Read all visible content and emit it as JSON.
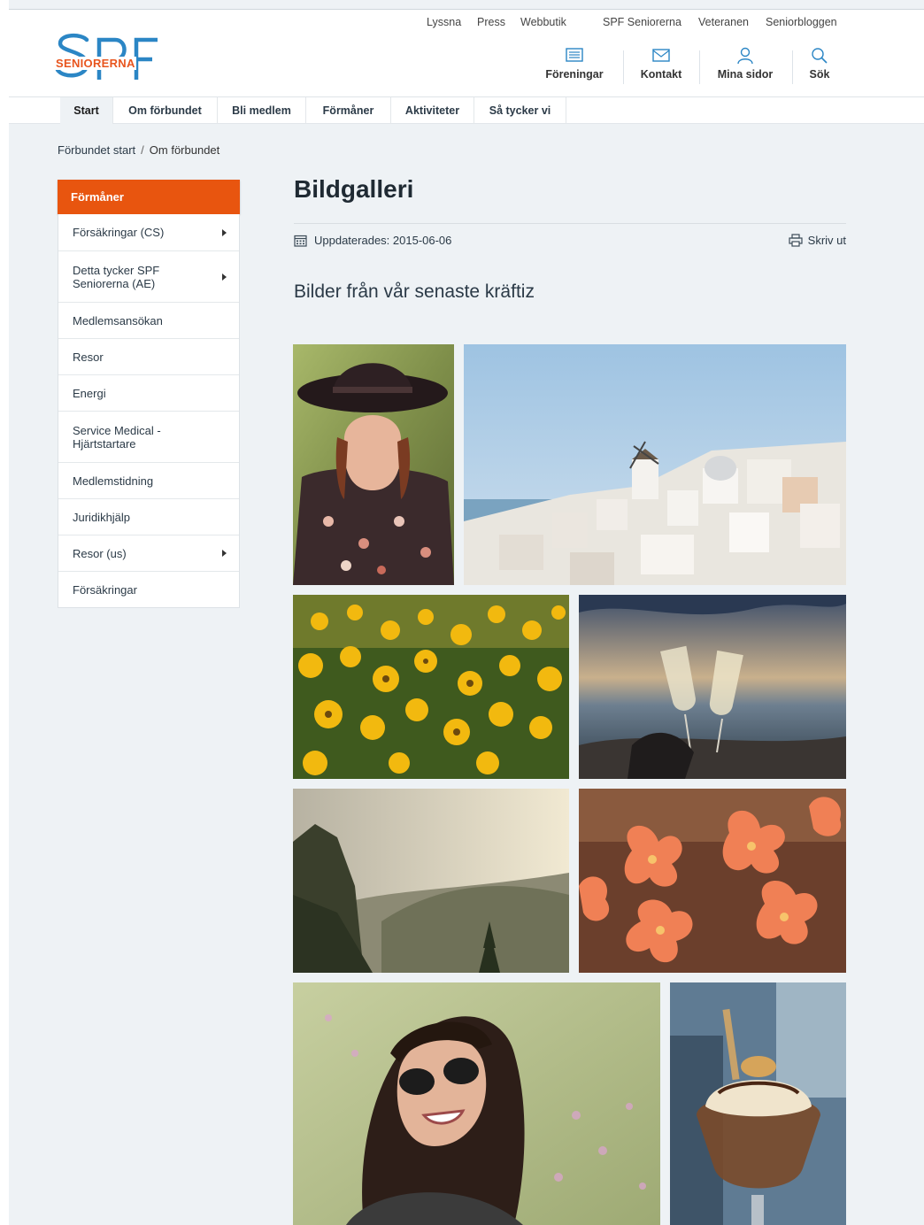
{
  "logo": {
    "text": "SENIORERNA",
    "letters": "SPF",
    "brand_blue": "#2b86c5",
    "brand_orange": "#e8551e"
  },
  "toplinks": [
    "Lyssna",
    "Press",
    "Webbutik",
    "SPF Seniorerna",
    "Veteranen",
    "Seniorbloggen"
  ],
  "tools": [
    {
      "label": "Föreningar",
      "icon": "list-icon"
    },
    {
      "label": "Kontakt",
      "icon": "mail-icon"
    },
    {
      "label": "Mina sidor",
      "icon": "user-icon"
    },
    {
      "label": "Sök",
      "icon": "search-icon"
    }
  ],
  "nav": [
    "Start",
    "Om förbundet",
    "Bli medlem",
    "Förmåner",
    "Aktiviteter",
    "Så tycker vi"
  ],
  "breadcrumb": {
    "home": "Förbundet start",
    "separator": "/",
    "current": "Om förbundet"
  },
  "sidebar": {
    "heading": "Förmåner",
    "items": [
      {
        "label": "Försäkringar (CS)",
        "has_children": true
      },
      {
        "label": "Detta tycker SPF Seniorerna (AE)",
        "has_children": true
      },
      {
        "label": "Medlemsansökan",
        "has_children": false
      },
      {
        "label": "Resor",
        "has_children": false
      },
      {
        "label": "Energi",
        "has_children": false
      },
      {
        "label": "Service Medical - Hjärtstartare",
        "has_children": false
      },
      {
        "label": "Medlemstidning",
        "has_children": false
      },
      {
        "label": "Juridikhjälp",
        "has_children": false
      },
      {
        "label": "Resor (us)",
        "has_children": true
      },
      {
        "label": "Försäkringar",
        "has_children": false
      }
    ]
  },
  "content": {
    "title": "Bildgalleri",
    "updated": "Uppdaterades: 2015-06-06",
    "print": "Skriv ut",
    "lead": "Bilder från vår senaste kräftiz"
  },
  "gallery": [
    {
      "subject": "woman-in-hat"
    },
    {
      "subject": "santorini-village"
    },
    {
      "subject": "yellow-flowers"
    },
    {
      "subject": "champagne-glasses"
    },
    {
      "subject": "mountain-valley"
    },
    {
      "subject": "orange-flowers"
    },
    {
      "subject": "woman-sunglasses"
    },
    {
      "subject": "ice-cream-sundae"
    }
  ]
}
